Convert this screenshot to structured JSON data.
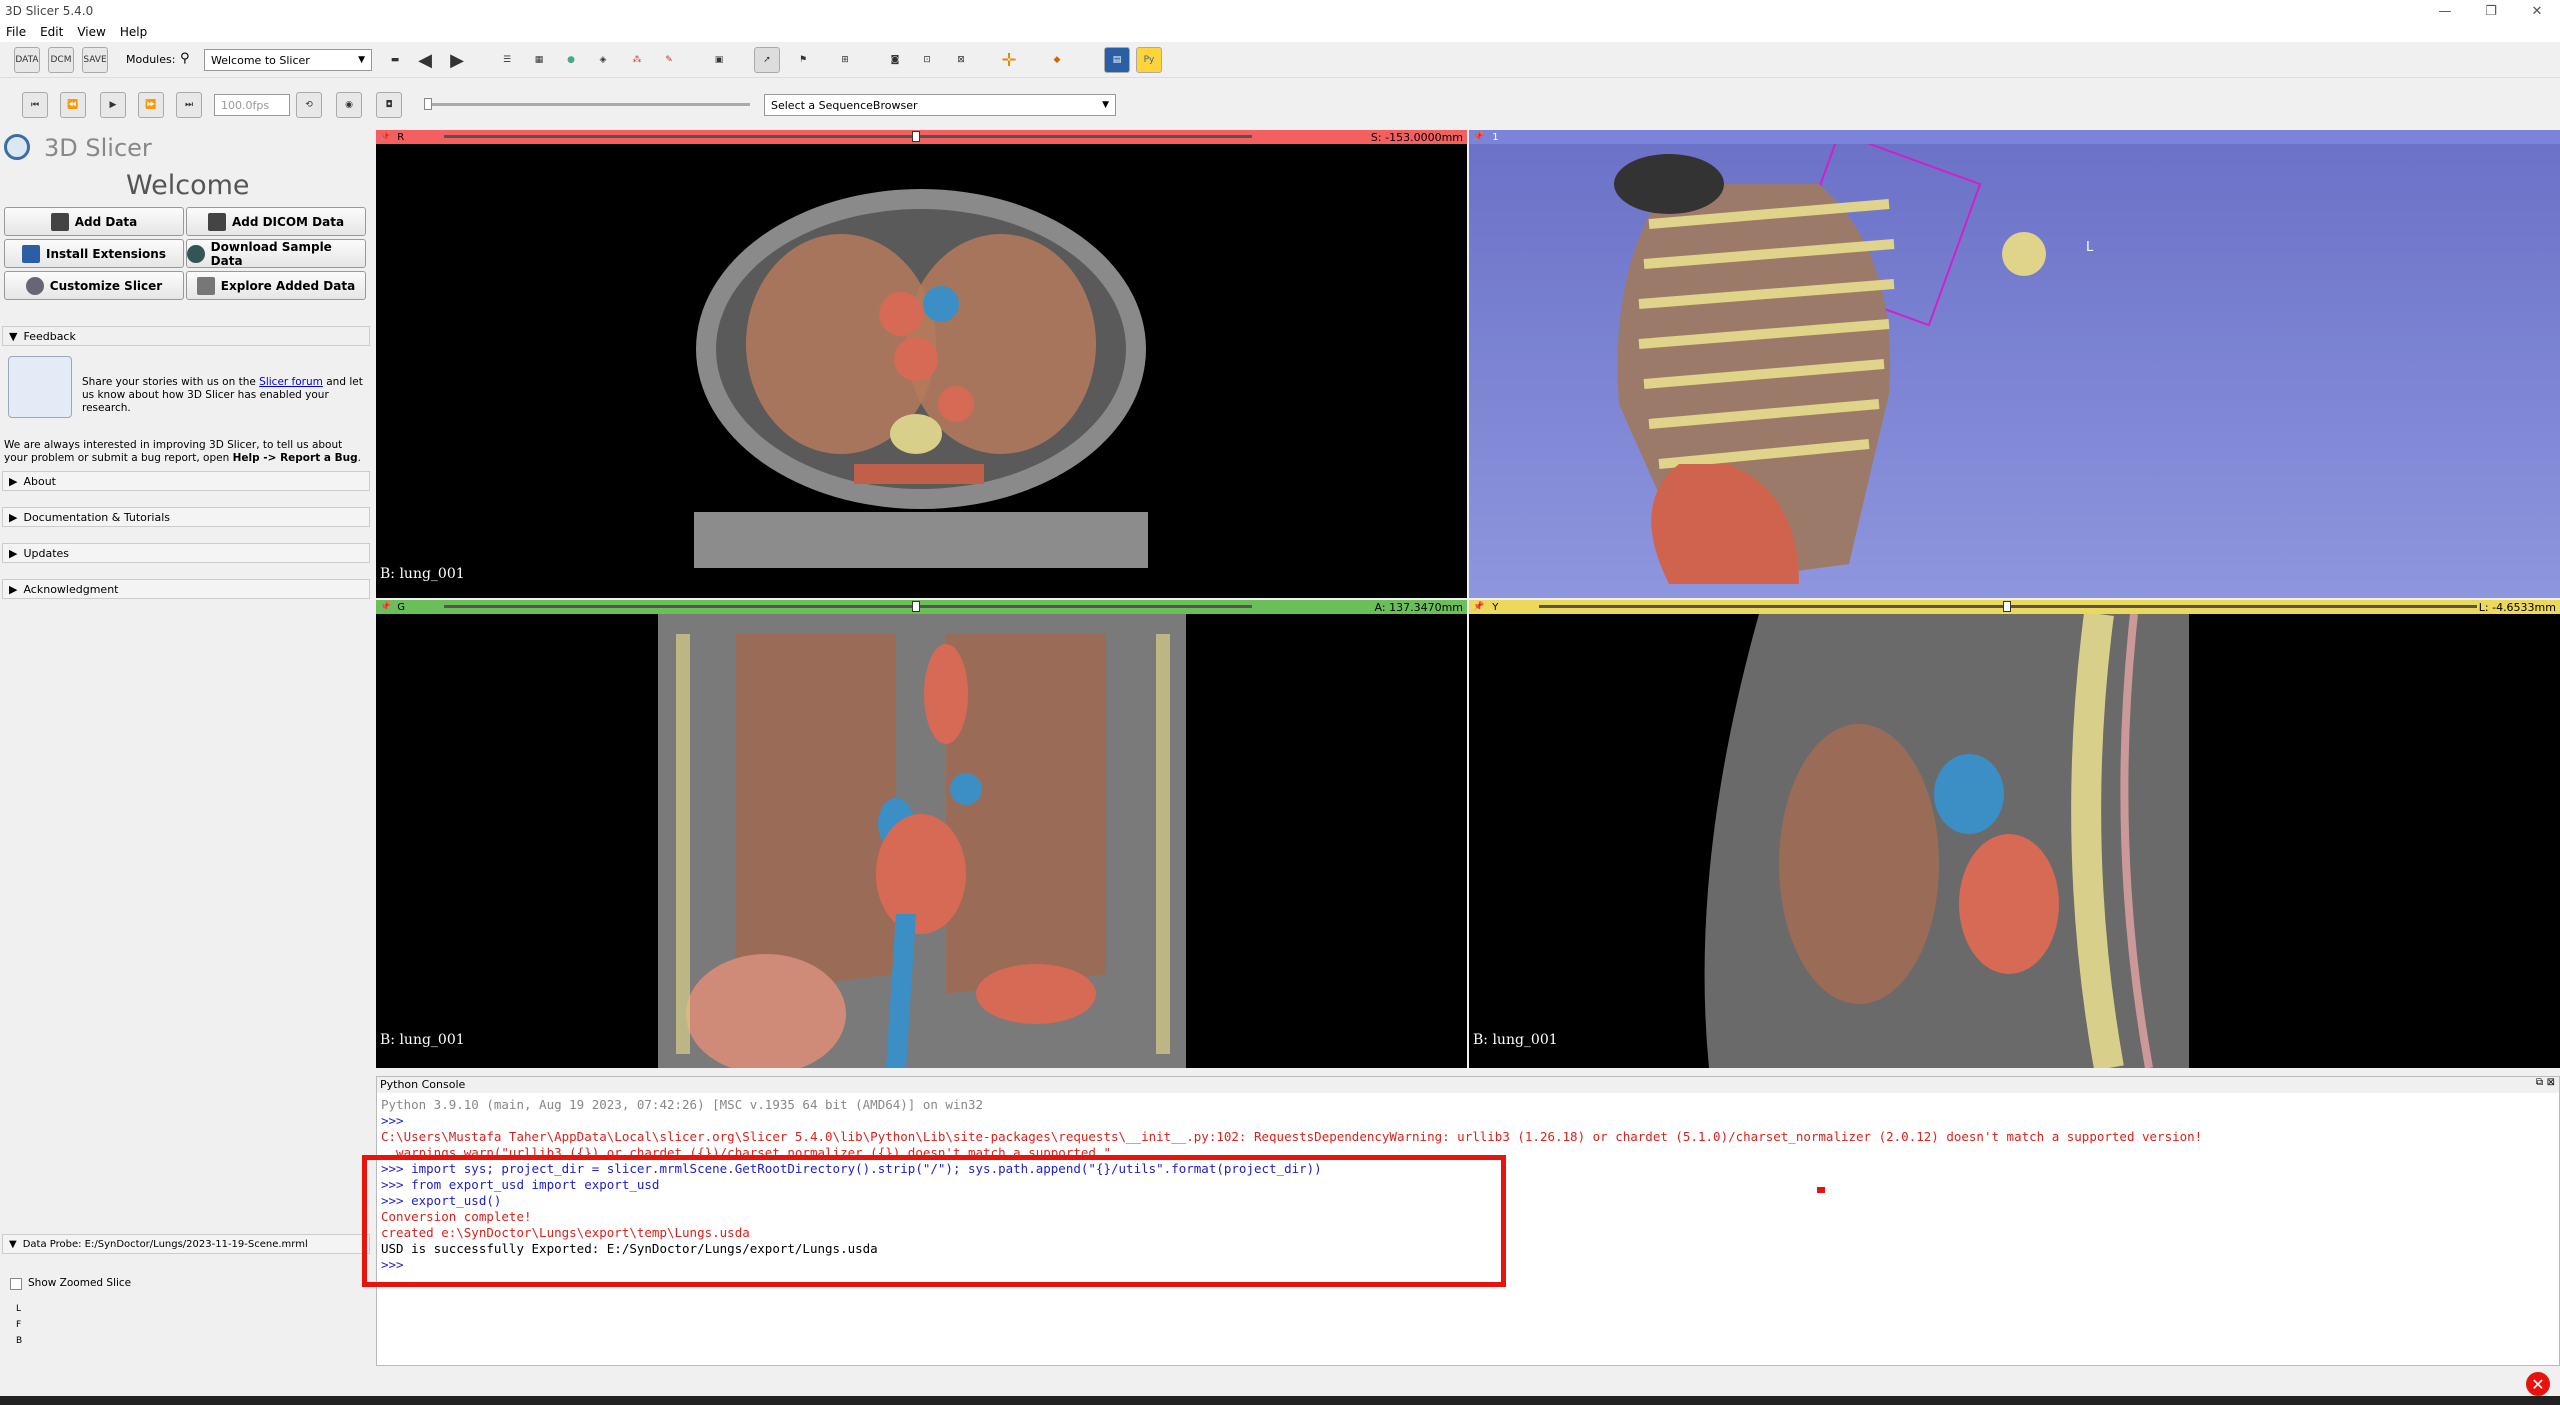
{
  "window": {
    "title": "3D Slicer 5.4.0",
    "controls": [
      "—",
      "❐",
      "✕"
    ]
  },
  "menu": [
    "File",
    "Edit",
    "View",
    "Help"
  ],
  "toolbar": {
    "modules_label": "Modules:",
    "module_selected": "Welcome to Slicer",
    "fps": "100.0fps",
    "sequence_browser": "Select a SequenceBrowser",
    "data_btn": "DATA",
    "dcm_btn": "DCM",
    "save_btn": "SAVE"
  },
  "welcome": {
    "app_name": "3D Slicer",
    "heading": "Welcome",
    "buttons": [
      "Add Data",
      "Add DICOM Data",
      "Install Extensions",
      "Download Sample Data",
      "Customize Slicer",
      "Explore Added Data"
    ],
    "feedback_title": "Feedback",
    "feedback_text1": "Share your stories with us on the ",
    "feedback_link": "Slicer forum",
    "feedback_text2": " and let us know about how 3D Slicer has enabled your research.",
    "improve_text1": "We are always interested in improving 3D Slicer, to tell us about your problem or submit a bug report, open ",
    "improve_bold": "Help -> Report a Bug",
    "improve_end": ".",
    "sections": [
      "About",
      "Documentation & Tutorials",
      "Updates",
      "Acknowledgment"
    ]
  },
  "views": {
    "red": {
      "letter": "R",
      "offset": "S: -153.0000mm",
      "label": "B: lung_001",
      "color": "#f46060"
    },
    "threed": {
      "letter": "1",
      "axis": "L",
      "color": "#7b84d8"
    },
    "green": {
      "letter": "G",
      "offset": "A: 137.3470mm",
      "label": "B: lung_001",
      "color": "#6bbf59"
    },
    "yellow": {
      "letter": "Y",
      "offset": "L: -4.6533mm",
      "label": "B: lung_001",
      "color": "#ecd85b"
    }
  },
  "console": {
    "title": "Python Console",
    "lines": [
      {
        "text": "Python 3.9.10 (main, Aug 19 2023, 07:42:26) [MSC v.1935 64 bit (AMD64)] on win32",
        "cls": "gray"
      },
      {
        "text": ">>>",
        "cls": "blue"
      },
      {
        "text": "C:\\Users\\Mustafa Taher\\AppData\\Local\\slicer.org\\Slicer 5.4.0\\lib\\Python\\Lib\\site-packages\\requests\\__init__.py:102: RequestsDependencyWarning: urllib3 (1.26.18) or chardet (5.1.0)/charset_normalizer (2.0.12) doesn't match a supported version!",
        "cls": "red"
      },
      {
        "text": "  warnings.warn(\"urllib3 ({}) or chardet ({})/charset_normalizer ({}) doesn't match a supported \"",
        "cls": "red"
      },
      {
        "text": ">>> import sys; project_dir = slicer.mrmlScene.GetRootDirectory().strip(\"/\"); sys.path.append(\"{}/utils\".format(project_dir))",
        "cls": "blue"
      },
      {
        "text": ">>> from export_usd import export_usd",
        "cls": "blue"
      },
      {
        "text": ">>> export_usd()",
        "cls": "blue"
      },
      {
        "text": "Conversion complete!",
        "cls": "red"
      },
      {
        "text": "created e:\\SynDoctor\\Lungs\\export\\temp\\Lungs.usda",
        "cls": "red"
      },
      {
        "text": "USD is successfully Exported: E:/SynDoctor/Lungs/export/Lungs.usda",
        "cls": "blk"
      },
      {
        "text": ">>>",
        "cls": "blue"
      }
    ]
  },
  "probe": {
    "title": "Data Probe: E:/SynDoctor/Lungs/2023-11-19-Scene.mrml",
    "checkbox": "Show Zoomed Slice",
    "letters": [
      "L",
      "F",
      "B"
    ]
  }
}
